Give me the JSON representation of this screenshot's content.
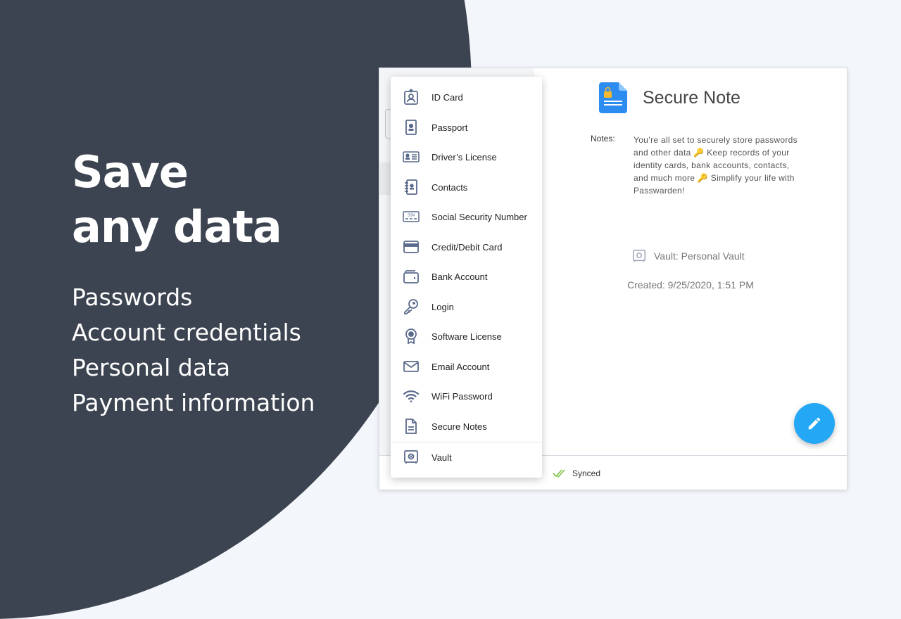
{
  "hero": {
    "title_line1": "Save",
    "title_line2": "any data",
    "features": [
      "Passwords",
      "Account credentials",
      "Personal data",
      "Payment information"
    ]
  },
  "menu": {
    "items": [
      {
        "label": "ID Card",
        "icon": "id-card-icon"
      },
      {
        "label": "Passport",
        "icon": "passport-icon"
      },
      {
        "label": "Driver’s License",
        "icon": "drivers-license-icon"
      },
      {
        "label": "Contacts",
        "icon": "contacts-icon"
      },
      {
        "label": "Social Security Number",
        "icon": "ssn-icon"
      },
      {
        "label": "Credit/Debit Card",
        "icon": "credit-card-icon"
      },
      {
        "label": "Bank Account",
        "icon": "wallet-icon"
      },
      {
        "label": "Login",
        "icon": "key-icon"
      },
      {
        "label": "Software License",
        "icon": "award-icon"
      },
      {
        "label": "Email Account",
        "icon": "envelope-icon"
      },
      {
        "label": "WiFi Password",
        "icon": "wifi-icon"
      },
      {
        "label": "Secure Notes",
        "icon": "document-icon"
      }
    ],
    "vault": {
      "label": "Vault",
      "icon": "safe-icon"
    },
    "ssn_icon_text": "SSN"
  },
  "detail": {
    "title": "Secure Note",
    "notes_label": "Notes:",
    "notes_text": "You’re all set to securely store passwords and other data 🔑 Keep records of your identity cards, bank accounts, contacts, and much more 🔑 Simplify your life with Passwarden!",
    "vault_label": "Vault: Personal Vault",
    "created": "Created: 9/25/2020, 1:51 PM"
  },
  "footer": {
    "status": "Synced"
  },
  "colors": {
    "accent": "#24a8f5",
    "icon": "#5a6a8c",
    "dark": "#3d4451",
    "synced": "#7cc242"
  }
}
